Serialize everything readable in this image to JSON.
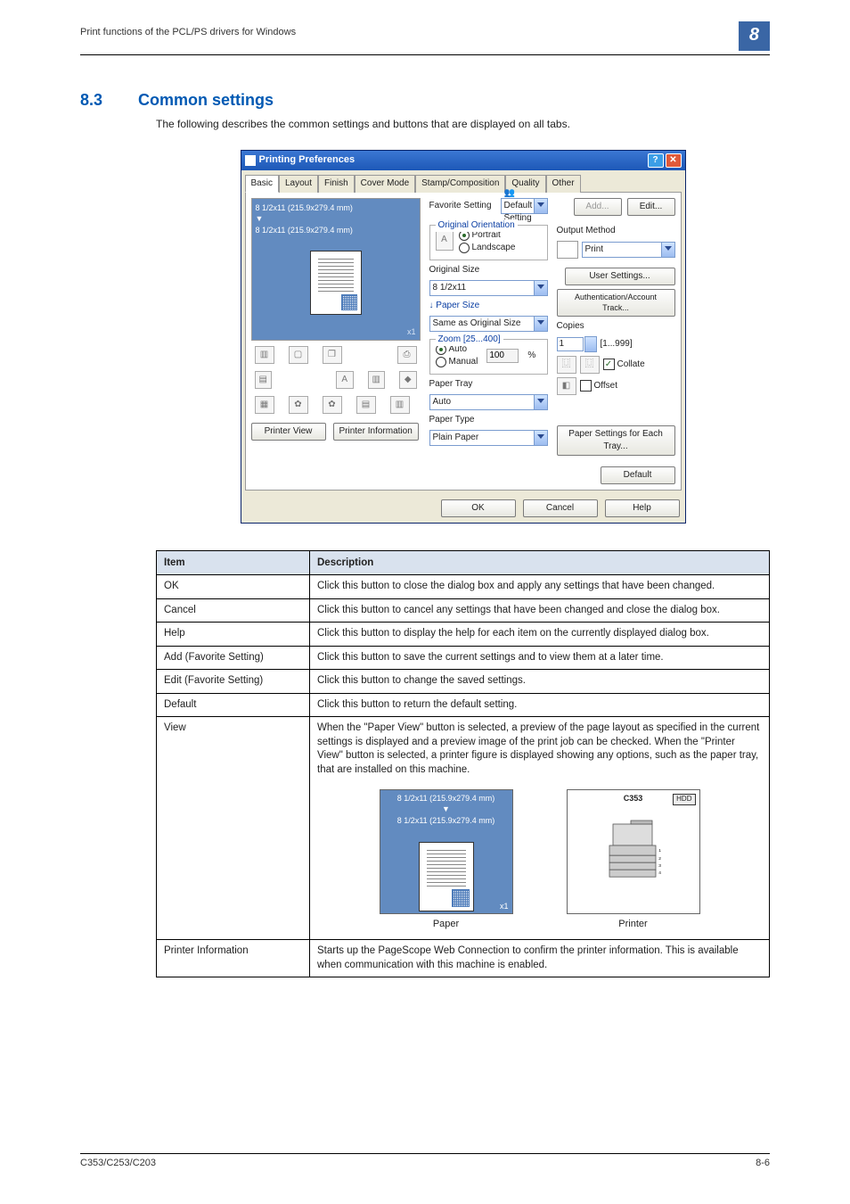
{
  "header": {
    "chapter_title": "Print functions of the PCL/PS drivers for Windows",
    "chapter_number": "8"
  },
  "section": {
    "number": "8.3",
    "title": "Common settings",
    "intro": "The following describes the common settings and buttons that are displayed on all tabs."
  },
  "dialog": {
    "title": "Printing Preferences",
    "help_glyph": "?",
    "close_glyph": "✕",
    "tabs": [
      "Basic",
      "Layout",
      "Finish",
      "Cover Mode",
      "Stamp/Composition",
      "Quality",
      "Other"
    ],
    "active_tab_index": 0,
    "favorite": {
      "label": "Favorite Setting",
      "value": "Default Setting",
      "add": "Add...",
      "edit": "Edit..."
    },
    "preview": {
      "line1": "8 1/2x11 (215.9x279.4 mm)",
      "line2": "8 1/2x11 (215.9x279.4 mm)",
      "corner": "x1"
    },
    "view_buttons": {
      "printer_view": "Printer View",
      "printer_info": "Printer Information"
    },
    "orientation": {
      "group": "Original Orientation",
      "portrait": "Portrait",
      "landscape": "Landscape"
    },
    "original_size": {
      "label": "Original Size",
      "value": "8 1/2x11"
    },
    "paper_size": {
      "label": "Paper Size",
      "arrow": "↓",
      "value": "Same as Original Size"
    },
    "zoom": {
      "label": "Zoom [25...400]",
      "auto": "Auto",
      "manual": "Manual",
      "value": "100",
      "unit": "%"
    },
    "paper_tray": {
      "label": "Paper Tray",
      "value": "Auto"
    },
    "paper_type": {
      "label": "Paper Type",
      "value": "Plain Paper"
    },
    "output_method": {
      "label": "Output Method",
      "value": "Print"
    },
    "user_settings_btn": "User Settings...",
    "auth_btn": "Authentication/Account Track...",
    "copies": {
      "label": "Copies",
      "value": "1",
      "range": "[1...999]",
      "collate": "Collate",
      "offset": "Offset"
    },
    "paper_settings_btn": "Paper Settings for Each Tray...",
    "default_btn": "Default",
    "footer": {
      "ok": "OK",
      "cancel": "Cancel",
      "help": "Help"
    }
  },
  "table": {
    "headers": {
      "item": "Item",
      "desc": "Description"
    },
    "rows": [
      {
        "item": "OK",
        "desc": "Click this button to close the dialog box and apply any settings that have been changed."
      },
      {
        "item": "Cancel",
        "desc": "Click this button to cancel any settings that have been changed and close the dialog box."
      },
      {
        "item": "Help",
        "desc": "Click this button to display the help for each item on the currently displayed dialog box."
      },
      {
        "item": "Add (Favorite Setting)",
        "desc": "Click this button to save the current settings and to view them at a later time."
      },
      {
        "item": "Edit (Favorite Setting)",
        "desc": "Click this button to change the saved settings."
      },
      {
        "item": "Default",
        "desc": "Click this button to return the default setting."
      }
    ],
    "view_row": {
      "item": "View",
      "desc": "When the \"Paper View\" button is selected, a preview of the page layout as specified in the current settings is displayed and a preview image of the print job can be checked. When the \"Printer View\" button is selected, a printer figure is displayed showing any options, such as the paper tray, that are installed on this machine.",
      "paper_caption": "Paper",
      "printer_caption": "Printer",
      "paper_line1": "8 1/2x11 (215.9x279.4 mm)",
      "paper_line2": "8 1/2x11 (215.9x279.4 mm)",
      "paper_corner": "x1",
      "printer_model": "C353",
      "hdd": "HDD"
    },
    "printer_info_row": {
      "item": "Printer Information",
      "desc": "Starts up the PageScope Web Connection to confirm the printer information. This is available when communication with this machine is enabled."
    }
  },
  "footer": {
    "left": "C353/C253/C203",
    "right": "8-6"
  }
}
